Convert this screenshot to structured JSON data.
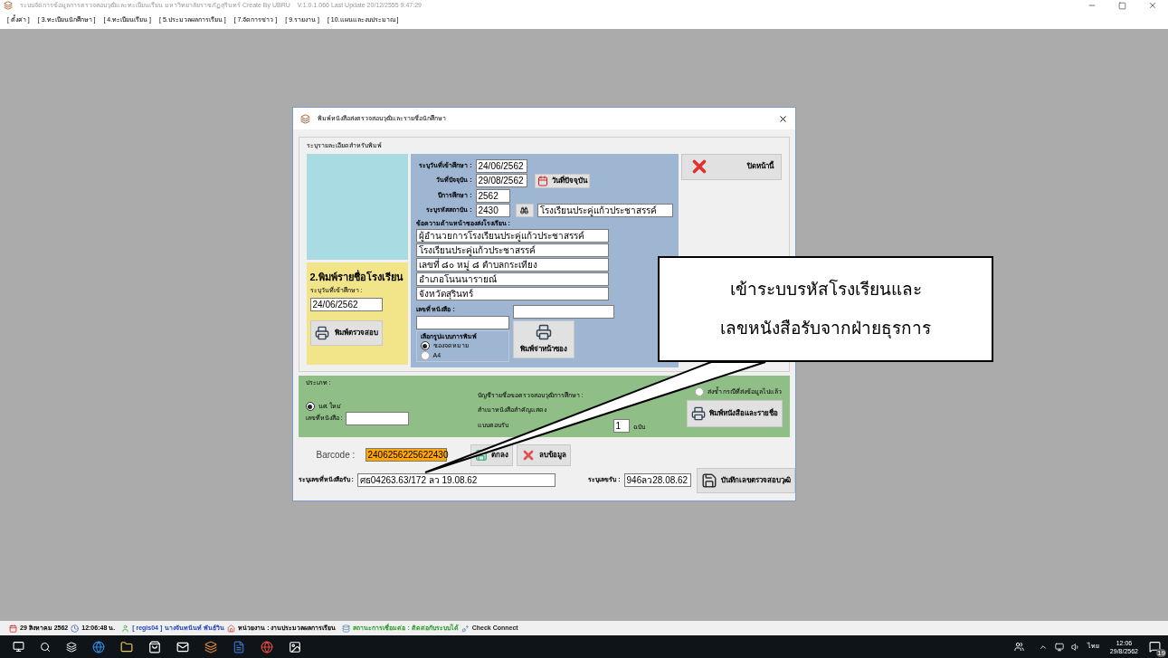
{
  "app_window": {
    "title": "ระบบจัดการข้อมูลการตรวจสอบวุฒิและทะเบียนเรียน มหาวิทยาลัยราชภัฏสุรินทร์ Create By UBRU",
    "version": "V.1.0.1.066 Last Update 20/12/2555 9:47:29",
    "menu": [
      "[ ตั้งค่า ]",
      "[ 3.ทะเบียนนักศึกษา ]",
      "[ 4.ทะเบียนเรียน ]",
      "[ 5.ประมวลผลการเรียน ]",
      "[ 7.จัดการข่าว ]",
      "[ 9.รายงาน ]",
      "[ 10.แผนและงบประมาณ ]"
    ]
  },
  "dialog": {
    "title": "พิมพ์หนังสือส่งตรวจสอบวุฒิและรายชื่อนักศึกษา",
    "section_label": "ระบุรายละเอียดสำหรับพิมพ์",
    "close_label": "ปิดหน้านี้",
    "fields": [
      {
        "label": "ระบุวันที่เข้าศึกษา :",
        "value": "24/06/2562"
      },
      {
        "label": "วันที่ปัจจุบัน :",
        "value": "29/08/2562"
      },
      {
        "label": "ปีการศึกษา :",
        "value": "2562"
      },
      {
        "label": "ระบุรหัสสถาบัน :",
        "value": "2430"
      }
    ],
    "today_button": "วันที่ปัจจุบัน",
    "school_name": "โรงเรียนประคู่แก้วประชาสรรค์",
    "envelope_label": "ข้อความด้านหน้าซองส่งโรงเรียน :",
    "envelope_lines": [
      "ผู้อำนวยการโรงเรียนประคู่แก้วประชาสรรค์",
      "โรงเรียนประคู่แก้วประชาสรรค์",
      "เลขที่ ๘๐ หมู่ ๘ ตำบลกระเทียง",
      "อำเภอโนนนารายณ์",
      "จังหวัดสุรินทร์"
    ],
    "doc_no_label": "เลขที่ หนังสือ :",
    "print_format": {
      "label": "เลือกรูปแบบการพิมพ์",
      "options": [
        {
          "label": "ซองจดหมาย",
          "selected": true
        },
        {
          "label": "A4",
          "selected": false
        }
      ]
    },
    "envelope_button": "พิมพ์จ่าหน้าซอง",
    "school_panel": {
      "title": "2.พิมพ์รายชื่อโรงเรียน",
      "label": "ระบุวันที่เข้าศึกษา :",
      "value": "24/06/2562",
      "button": "พิมพ์ตรวจสอบ"
    },
    "type_panel": {
      "label": "ประเภท :",
      "options": [
        {
          "label": "นศ. ใหม่",
          "selected": true
        },
        {
          "label": "ส่งซ้ำ กรณีที่ส่งข้อมูลไปแล้ว",
          "selected": false
        }
      ],
      "doc_label": "เลขที่หนังสือ :",
      "lines": [
        "บัญชีรายชื่อขอตรวจสอบวุฒิการศึกษา :",
        "สำเนาหนังสือสำคัญแสดง",
        "แบบตอบรับ"
      ],
      "copies": "1",
      "copies_unit": "ฉบับ",
      "print_button": "พิมพ์หนังสือและรายชื่อ"
    },
    "barcode_label": "Barcode :",
    "barcode": "2406256225622430",
    "ok_button": "ตกลง",
    "delete_button": "ลบข้อมูล",
    "received_doc_label": "ระบุเลขที่หนังสือรับ :",
    "received_doc": "ศธ04263.63/172 ลว 19.08.62",
    "received_no_label": "ระบุเลขรับ :",
    "received_no": "946ลว28.08.62",
    "save_button": "บันทึกเลขตรวจสอบวุฒิ"
  },
  "callout": [
    "เข้าระบบรหัสโรงเรียนและ",
    "เลขหนังสือรับจากฝ่ายธุรการ"
  ],
  "status_bar": {
    "date": "29 สิงหาคม 2562",
    "time": "12:06:48 น.",
    "user": "[ regis04 ]",
    "user_name": "นางจันทนันท์ พันธ์วิน",
    "unit": "หน่วยงาน : งานประมวลผลการเรียน",
    "connection": "สถานะการเชื่อมต่อ : ติดต่อกับระบบได้",
    "check": "Check Connect"
  },
  "taskbar": {
    "language": "ไทย",
    "time": "12:06",
    "date": "29/8/2562",
    "notifications": "19"
  }
}
